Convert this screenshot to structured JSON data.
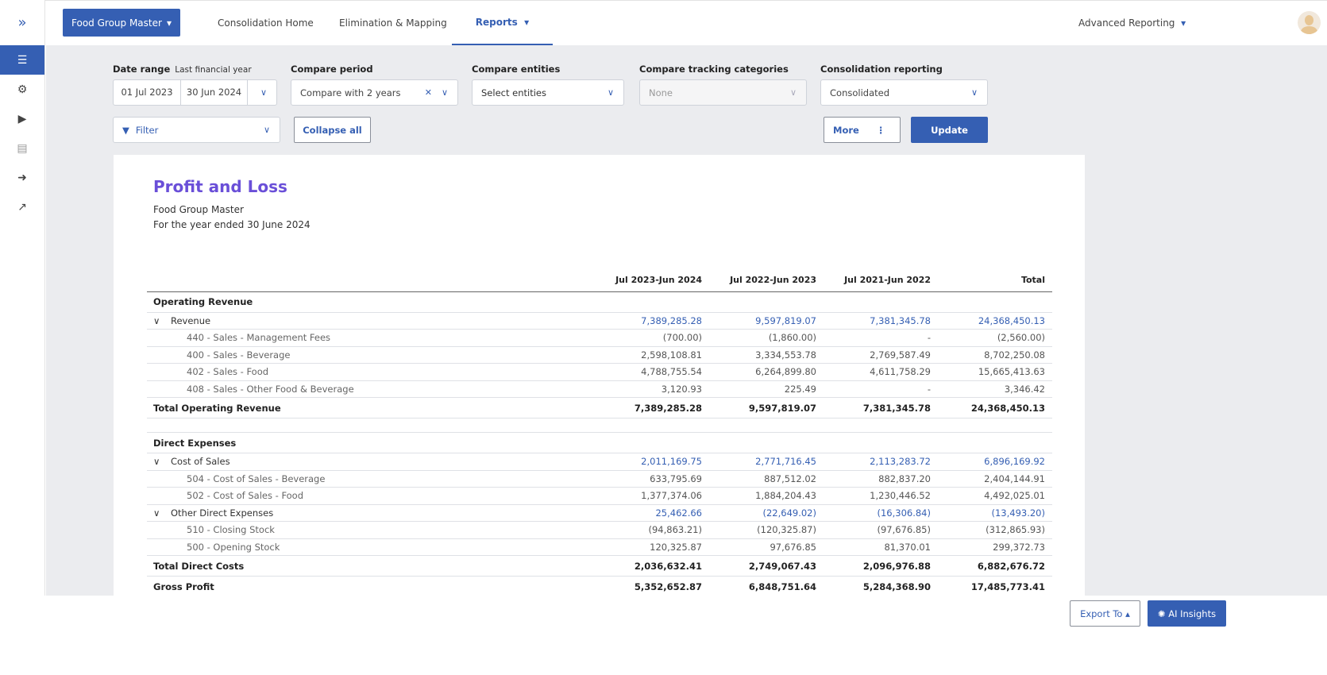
{
  "nav": {
    "brand": "Food Group Master",
    "links": [
      "Consolidation Home",
      "Elimination & Mapping"
    ],
    "active": "Reports",
    "right": "Advanced Reporting"
  },
  "filters": {
    "date_range_label": "Date range",
    "date_range_hint": "Last financial year",
    "date_from": "01 Jul 2023",
    "date_to": "30 Jun 2024",
    "compare_period_label": "Compare period",
    "compare_period_value": "Compare with 2 years",
    "compare_entities_label": "Compare entities",
    "compare_entities_placeholder": "Select entities",
    "tracking_label": "Compare tracking categories",
    "tracking_value": "None",
    "consolidation_label": "Consolidation reporting",
    "consolidation_value": "Consolidated",
    "filter": "Filter",
    "collapse_all": "Collapse all",
    "more": "More",
    "update": "Update"
  },
  "report": {
    "title": "Profit and Loss",
    "entity": "Food Group Master",
    "period": "For the year ended 30 June 2024",
    "columns": [
      "",
      "Jul 2023-Jun 2024",
      "Jul 2022-Jun 2023",
      "Jul 2021-Jun 2022",
      "Total"
    ],
    "rows": [
      {
        "type": "section",
        "cells": [
          "Operating Revenue",
          "",
          "",
          "",
          ""
        ]
      },
      {
        "type": "group",
        "cells": [
          "Revenue",
          "7,389,285.28",
          "9,597,819.07",
          "7,381,345.78",
          "24,368,450.13"
        ]
      },
      {
        "type": "item",
        "cells": [
          "440 - Sales - Management Fees",
          "(700.00)",
          "(1,860.00)",
          "-",
          "(2,560.00)"
        ]
      },
      {
        "type": "item",
        "cells": [
          "400 - Sales - Beverage",
          "2,598,108.81",
          "3,334,553.78",
          "2,769,587.49",
          "8,702,250.08"
        ]
      },
      {
        "type": "item",
        "cells": [
          "402 - Sales - Food",
          "4,788,755.54",
          "6,264,899.80",
          "4,611,758.29",
          "15,665,413.63"
        ]
      },
      {
        "type": "item",
        "cells": [
          "408 - Sales - Other Food & Beverage",
          "3,120.93",
          "225.49",
          "-",
          "3,346.42"
        ]
      },
      {
        "type": "total",
        "cells": [
          "Total Operating Revenue",
          "7,389,285.28",
          "9,597,819.07",
          "7,381,345.78",
          "24,368,450.13"
        ]
      },
      {
        "type": "spacer",
        "cells": [
          "",
          "",
          "",
          "",
          ""
        ]
      },
      {
        "type": "section",
        "cells": [
          "Direct Expenses",
          "",
          "",
          "",
          ""
        ]
      },
      {
        "type": "group",
        "cells": [
          "Cost of Sales",
          "2,011,169.75",
          "2,771,716.45",
          "2,113,283.72",
          "6,896,169.92"
        ]
      },
      {
        "type": "item",
        "cells": [
          "504 - Cost of Sales - Beverage",
          "633,795.69",
          "887,512.02",
          "882,837.20",
          "2,404,144.91"
        ]
      },
      {
        "type": "item",
        "cells": [
          "502 - Cost of Sales - Food",
          "1,377,374.06",
          "1,884,204.43",
          "1,230,446.52",
          "4,492,025.01"
        ]
      },
      {
        "type": "group",
        "cells": [
          "Other Direct Expenses",
          "25,462.66",
          "(22,649.02)",
          "(16,306.84)",
          "(13,493.20)"
        ]
      },
      {
        "type": "item",
        "cells": [
          "510 - Closing Stock",
          "(94,863.21)",
          "(120,325.87)",
          "(97,676.85)",
          "(312,865.93)"
        ]
      },
      {
        "type": "item",
        "cells": [
          "500 - Opening Stock",
          "120,325.87",
          "97,676.85",
          "81,370.01",
          "299,372.73"
        ]
      },
      {
        "type": "total",
        "cells": [
          "Total Direct Costs",
          "2,036,632.41",
          "2,749,067.43",
          "2,096,976.88",
          "6,882,676.72"
        ]
      },
      {
        "type": "total",
        "cells": [
          "Gross Profit",
          "5,352,652.87",
          "6,848,751.64",
          "5,284,368.90",
          "17,485,773.41"
        ]
      }
    ]
  },
  "footer": {
    "export": "Export To",
    "ai": "AI Insights"
  },
  "colors": {
    "primary": "#355fb3",
    "title": "#6a4fd8"
  }
}
